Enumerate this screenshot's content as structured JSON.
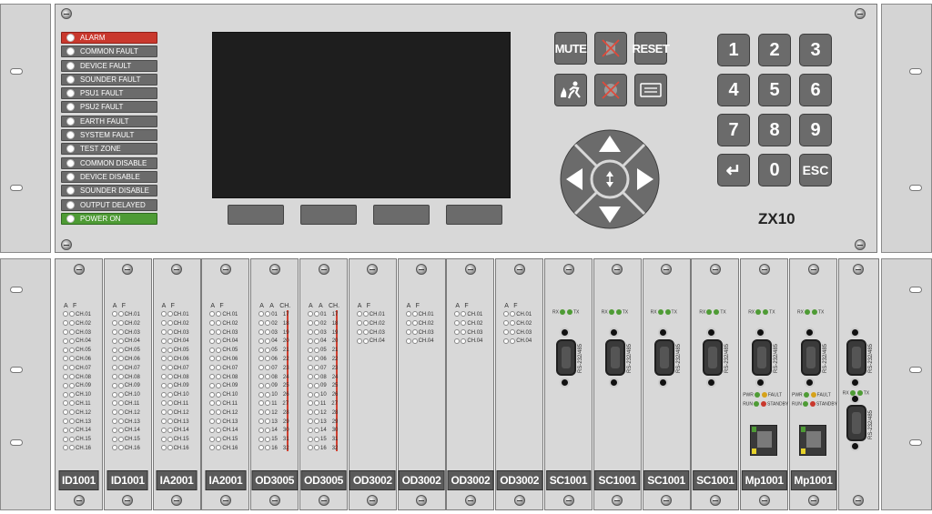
{
  "status_leds": [
    {
      "label": "ALARM",
      "state": "red"
    },
    {
      "label": "COMMON FAULT",
      "state": "off"
    },
    {
      "label": "DEVICE FAULT",
      "state": "off"
    },
    {
      "label": "SOUNDER FAULT",
      "state": "off"
    },
    {
      "label": "PSU1 FAULT",
      "state": "off"
    },
    {
      "label": "PSU2 FAULT",
      "state": "off"
    },
    {
      "label": "EARTH FAULT",
      "state": "off"
    },
    {
      "label": "SYSTEM FAULT",
      "state": "off"
    },
    {
      "label": "TEST ZONE",
      "state": "off"
    },
    {
      "label": "COMMON DISABLE",
      "state": "off"
    },
    {
      "label": "DEVICE DISABLE",
      "state": "off"
    },
    {
      "label": "SOUNDER DISABLE",
      "state": "off"
    },
    {
      "label": "OUTPUT DELAYED",
      "state": "off"
    },
    {
      "label": "POWER ON",
      "state": "green"
    }
  ],
  "control_buttons": {
    "mute": "MUTE",
    "reset": "RESET"
  },
  "keypad": [
    "1",
    "2",
    "3",
    "4",
    "5",
    "6",
    "7",
    "8",
    "9",
    "↵",
    "0",
    "ESC"
  ],
  "model": "ZX10",
  "cards": [
    {
      "label": "ID1001",
      "type": "input16"
    },
    {
      "label": "ID1001",
      "type": "input16"
    },
    {
      "label": "IA2001",
      "type": "input16"
    },
    {
      "label": "IA2001",
      "type": "input16"
    },
    {
      "label": "OD3005",
      "type": "output32"
    },
    {
      "label": "OD3005",
      "type": "output32"
    },
    {
      "label": "OD3002",
      "type": "output4"
    },
    {
      "label": "OD3002",
      "type": "output4"
    },
    {
      "label": "OD3002",
      "type": "output4"
    },
    {
      "label": "OD3002",
      "type": "output4"
    },
    {
      "label": "SC1001",
      "type": "serial"
    },
    {
      "label": "SC1001",
      "type": "serial"
    },
    {
      "label": "SC1001",
      "type": "serial"
    },
    {
      "label": "SC1001",
      "type": "serial"
    },
    {
      "label": "Mp1001",
      "type": "mp"
    },
    {
      "label": "Mp1001",
      "type": "mp"
    },
    {
      "label": "",
      "type": "dual-serial"
    }
  ],
  "card_text": {
    "col_a": "A",
    "col_f": "F",
    "col_ch": "CH.",
    "channels16": [
      "CH.01",
      "CH.02",
      "CH.03",
      "CH.04",
      "CH.05",
      "CH.06",
      "CH.07",
      "CH.08",
      "CH.09",
      "CH.10",
      "CH.11",
      "CH.12",
      "CH.13",
      "CH.14",
      "CH.15",
      "CH.16"
    ],
    "channels4": [
      "CH.01",
      "CH.02",
      "CH.03",
      "CH.04"
    ],
    "out_left": [
      "01",
      "02",
      "03",
      "04",
      "05",
      "06",
      "07",
      "08",
      "09",
      "10",
      "11",
      "12",
      "13",
      "14",
      "15",
      "16"
    ],
    "out_right": [
      "17",
      "18",
      "19",
      "20",
      "21",
      "22",
      "23",
      "24",
      "25",
      "26",
      "27",
      "28",
      "29",
      "30",
      "31",
      "32"
    ],
    "rx": "RX",
    "tx": "TX",
    "rs": "RS-232/485",
    "pwr": "PWR",
    "fault": "FAULT",
    "run": "RUN",
    "standby": "STANDBY"
  },
  "colors": {
    "panel": "#d8d8d8",
    "button": "#6b6b6b",
    "alarm": "#c9382d",
    "power": "#4e9b35"
  }
}
